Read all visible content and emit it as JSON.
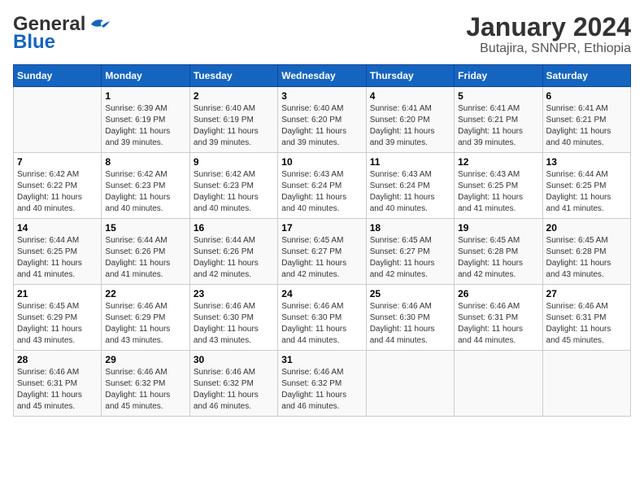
{
  "header": {
    "logo_general": "General",
    "logo_blue": "Blue",
    "title": "January 2024",
    "subtitle": "Butajira, SNNPR, Ethiopia"
  },
  "days_of_week": [
    "Sunday",
    "Monday",
    "Tuesday",
    "Wednesday",
    "Thursday",
    "Friday",
    "Saturday"
  ],
  "weeks": [
    [
      {
        "num": "",
        "info": ""
      },
      {
        "num": "1",
        "info": "Sunrise: 6:39 AM\nSunset: 6:19 PM\nDaylight: 11 hours\nand 39 minutes."
      },
      {
        "num": "2",
        "info": "Sunrise: 6:40 AM\nSunset: 6:19 PM\nDaylight: 11 hours\nand 39 minutes."
      },
      {
        "num": "3",
        "info": "Sunrise: 6:40 AM\nSunset: 6:20 PM\nDaylight: 11 hours\nand 39 minutes."
      },
      {
        "num": "4",
        "info": "Sunrise: 6:41 AM\nSunset: 6:20 PM\nDaylight: 11 hours\nand 39 minutes."
      },
      {
        "num": "5",
        "info": "Sunrise: 6:41 AM\nSunset: 6:21 PM\nDaylight: 11 hours\nand 39 minutes."
      },
      {
        "num": "6",
        "info": "Sunrise: 6:41 AM\nSunset: 6:21 PM\nDaylight: 11 hours\nand 40 minutes."
      }
    ],
    [
      {
        "num": "7",
        "info": "Sunrise: 6:42 AM\nSunset: 6:22 PM\nDaylight: 11 hours\nand 40 minutes."
      },
      {
        "num": "8",
        "info": "Sunrise: 6:42 AM\nSunset: 6:23 PM\nDaylight: 11 hours\nand 40 minutes."
      },
      {
        "num": "9",
        "info": "Sunrise: 6:42 AM\nSunset: 6:23 PM\nDaylight: 11 hours\nand 40 minutes."
      },
      {
        "num": "10",
        "info": "Sunrise: 6:43 AM\nSunset: 6:24 PM\nDaylight: 11 hours\nand 40 minutes."
      },
      {
        "num": "11",
        "info": "Sunrise: 6:43 AM\nSunset: 6:24 PM\nDaylight: 11 hours\nand 40 minutes."
      },
      {
        "num": "12",
        "info": "Sunrise: 6:43 AM\nSunset: 6:25 PM\nDaylight: 11 hours\nand 41 minutes."
      },
      {
        "num": "13",
        "info": "Sunrise: 6:44 AM\nSunset: 6:25 PM\nDaylight: 11 hours\nand 41 minutes."
      }
    ],
    [
      {
        "num": "14",
        "info": "Sunrise: 6:44 AM\nSunset: 6:25 PM\nDaylight: 11 hours\nand 41 minutes."
      },
      {
        "num": "15",
        "info": "Sunrise: 6:44 AM\nSunset: 6:26 PM\nDaylight: 11 hours\nand 41 minutes."
      },
      {
        "num": "16",
        "info": "Sunrise: 6:44 AM\nSunset: 6:26 PM\nDaylight: 11 hours\nand 42 minutes."
      },
      {
        "num": "17",
        "info": "Sunrise: 6:45 AM\nSunset: 6:27 PM\nDaylight: 11 hours\nand 42 minutes."
      },
      {
        "num": "18",
        "info": "Sunrise: 6:45 AM\nSunset: 6:27 PM\nDaylight: 11 hours\nand 42 minutes."
      },
      {
        "num": "19",
        "info": "Sunrise: 6:45 AM\nSunset: 6:28 PM\nDaylight: 11 hours\nand 42 minutes."
      },
      {
        "num": "20",
        "info": "Sunrise: 6:45 AM\nSunset: 6:28 PM\nDaylight: 11 hours\nand 43 minutes."
      }
    ],
    [
      {
        "num": "21",
        "info": "Sunrise: 6:45 AM\nSunset: 6:29 PM\nDaylight: 11 hours\nand 43 minutes."
      },
      {
        "num": "22",
        "info": "Sunrise: 6:46 AM\nSunset: 6:29 PM\nDaylight: 11 hours\nand 43 minutes."
      },
      {
        "num": "23",
        "info": "Sunrise: 6:46 AM\nSunset: 6:30 PM\nDaylight: 11 hours\nand 43 minutes."
      },
      {
        "num": "24",
        "info": "Sunrise: 6:46 AM\nSunset: 6:30 PM\nDaylight: 11 hours\nand 44 minutes."
      },
      {
        "num": "25",
        "info": "Sunrise: 6:46 AM\nSunset: 6:30 PM\nDaylight: 11 hours\nand 44 minutes."
      },
      {
        "num": "26",
        "info": "Sunrise: 6:46 AM\nSunset: 6:31 PM\nDaylight: 11 hours\nand 44 minutes."
      },
      {
        "num": "27",
        "info": "Sunrise: 6:46 AM\nSunset: 6:31 PM\nDaylight: 11 hours\nand 45 minutes."
      }
    ],
    [
      {
        "num": "28",
        "info": "Sunrise: 6:46 AM\nSunset: 6:31 PM\nDaylight: 11 hours\nand 45 minutes."
      },
      {
        "num": "29",
        "info": "Sunrise: 6:46 AM\nSunset: 6:32 PM\nDaylight: 11 hours\nand 45 minutes."
      },
      {
        "num": "30",
        "info": "Sunrise: 6:46 AM\nSunset: 6:32 PM\nDaylight: 11 hours\nand 46 minutes."
      },
      {
        "num": "31",
        "info": "Sunrise: 6:46 AM\nSunset: 6:32 PM\nDaylight: 11 hours\nand 46 minutes."
      },
      {
        "num": "",
        "info": ""
      },
      {
        "num": "",
        "info": ""
      },
      {
        "num": "",
        "info": ""
      }
    ]
  ]
}
